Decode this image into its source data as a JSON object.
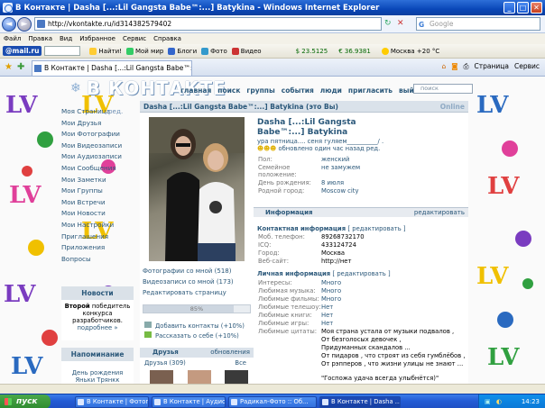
{
  "window": {
    "title": "В Контакте | Dasha [...:Lil Gangsta Babe™:...] Batykina - Windows Internet Explorer",
    "min": "_",
    "max": "□",
    "close": "✕"
  },
  "address": {
    "url": "http://vkontakte.ru/id314382579402",
    "search_placeholder": "Google"
  },
  "menu": [
    "Файл",
    "Правка",
    "Вид",
    "Избранное",
    "Сервис",
    "Справка"
  ],
  "toolbar": {
    "brand": "@mail.ru",
    "find": "Найти!",
    "items": [
      "Мой мир",
      "Блоги",
      "Фото",
      "Видео"
    ],
    "usd": "$ 23.5125",
    "eur": "€ 36.9381",
    "weather": "Москва +20 °C"
  },
  "tab": {
    "label": "В Контакте | Dasha [...:Lil Gangsta Babe™:...] Baty...",
    "page_btn": "Страница",
    "tools_btn": "Сервис"
  },
  "vk": {
    "logo": "В КОНТАКТЕ",
    "nav": [
      "главная",
      "поиск",
      "группы",
      "события",
      "люди",
      "пригласить",
      "выйти"
    ],
    "search": "поиск",
    "left_menu": [
      "Моя Страница",
      "ред.",
      "Мои Друзья",
      "Мои Фотографии",
      "Мои Видеозаписи",
      "Мои Аудиозаписи",
      "Мои Сообщения",
      "Мои Заметки",
      "Мои Группы",
      "Мои Встречи",
      "Мои Новости",
      "Мои Настройки",
      "Приглашения",
      "Приложения",
      "Вопросы"
    ],
    "news_head": "Новости",
    "news_body_bold": "Второй",
    "news_body": "победитель конкурса разработчиков.",
    "news_more": "подробнее »",
    "remind_head": "Напоминание",
    "remind_text": "День рождения",
    "remind_name": "Яньки Трянкк"
  },
  "profile": {
    "head": "Dasha [...:Lil Gangsta Babe™:...] Batykina (это Вы)",
    "online": "Online",
    "name_line1": "Dasha [...:Lil Gangsta",
    "name_line2": "Babe™:...] Batykina",
    "status": "ура пятница.... сеня гуляем__________/ .",
    "status_updated": "обновлено один час назад ред.",
    "photo_links": [
      "Фотографии со мной (518)",
      "Видеозаписи со мной (173)",
      "Редактировать страницу"
    ],
    "progress_text": "85%",
    "progress_value": 0.85,
    "add_contacts": "Добавить контакты (+10%)",
    "tell_about": "Рассказать о себе (+10%)",
    "friends_head": "Друзья",
    "friends_updates": "обновления",
    "friends_count": "Друзья (309)",
    "friends_all": "Все",
    "basic": [
      {
        "l": "Пол:",
        "v": "женский"
      },
      {
        "l": "Семейное положение:",
        "v": "не замужем"
      },
      {
        "l": "День рождения:",
        "v": "8 июля"
      },
      {
        "l": "Родной город:",
        "v": "Moscow city"
      }
    ],
    "info_head": "Информация",
    "info_edit": "редактировать",
    "contact_head": "Контактная информация",
    "contact_edit": "[ редактировать ]",
    "contacts": [
      {
        "l": "Моб. телефон:",
        "v": "89268732170"
      },
      {
        "l": "ICQ:",
        "v": "433124724"
      },
      {
        "l": "Город:",
        "v": "Москва"
      },
      {
        "l": "Веб-сайт:",
        "v": "http://нет"
      }
    ],
    "personal_head": "Личная информация",
    "personal_edit": "[ редактировать ]",
    "personal": [
      {
        "l": "Интересы:",
        "v": "Много"
      },
      {
        "l": "Любимая музыка:",
        "v": "Много"
      },
      {
        "l": "Любимые фильмы:",
        "v": "Много"
      },
      {
        "l": "Любимые телешоу:",
        "v": "Нет"
      },
      {
        "l": "Любимые книги:",
        "v": "Нет"
      },
      {
        "l": "Любимые игры:",
        "v": "Нет"
      }
    ],
    "quotes_label": "Любимые цитаты:",
    "quotes": [
      "Моя страна устала от музыки подвалов ,",
      "От безголосых девочек ,",
      "Придуманных скандалов ...",
      "От пидаров , что строят из себя гумблёбов ,",
      "От рэпперов , что жизни улицы не знают ..."
    ],
    "quote2": "\"Госпожа удача всегда улыбнётся)\""
  },
  "statusbar": "",
  "taskbar": {
    "start": "пуск",
    "tasks": [
      "В Контакте | Фотог...",
      "В Контакте | Аудио ...",
      "Радикал-Фото :: Об...",
      "В Контакте | Dasha ..."
    ],
    "lang": "RU",
    "time": "14:23"
  },
  "colors": {
    "vk_blue": "#2b587a",
    "vk_header": "#dae2ea",
    "xp_blue": "#245dd6"
  }
}
